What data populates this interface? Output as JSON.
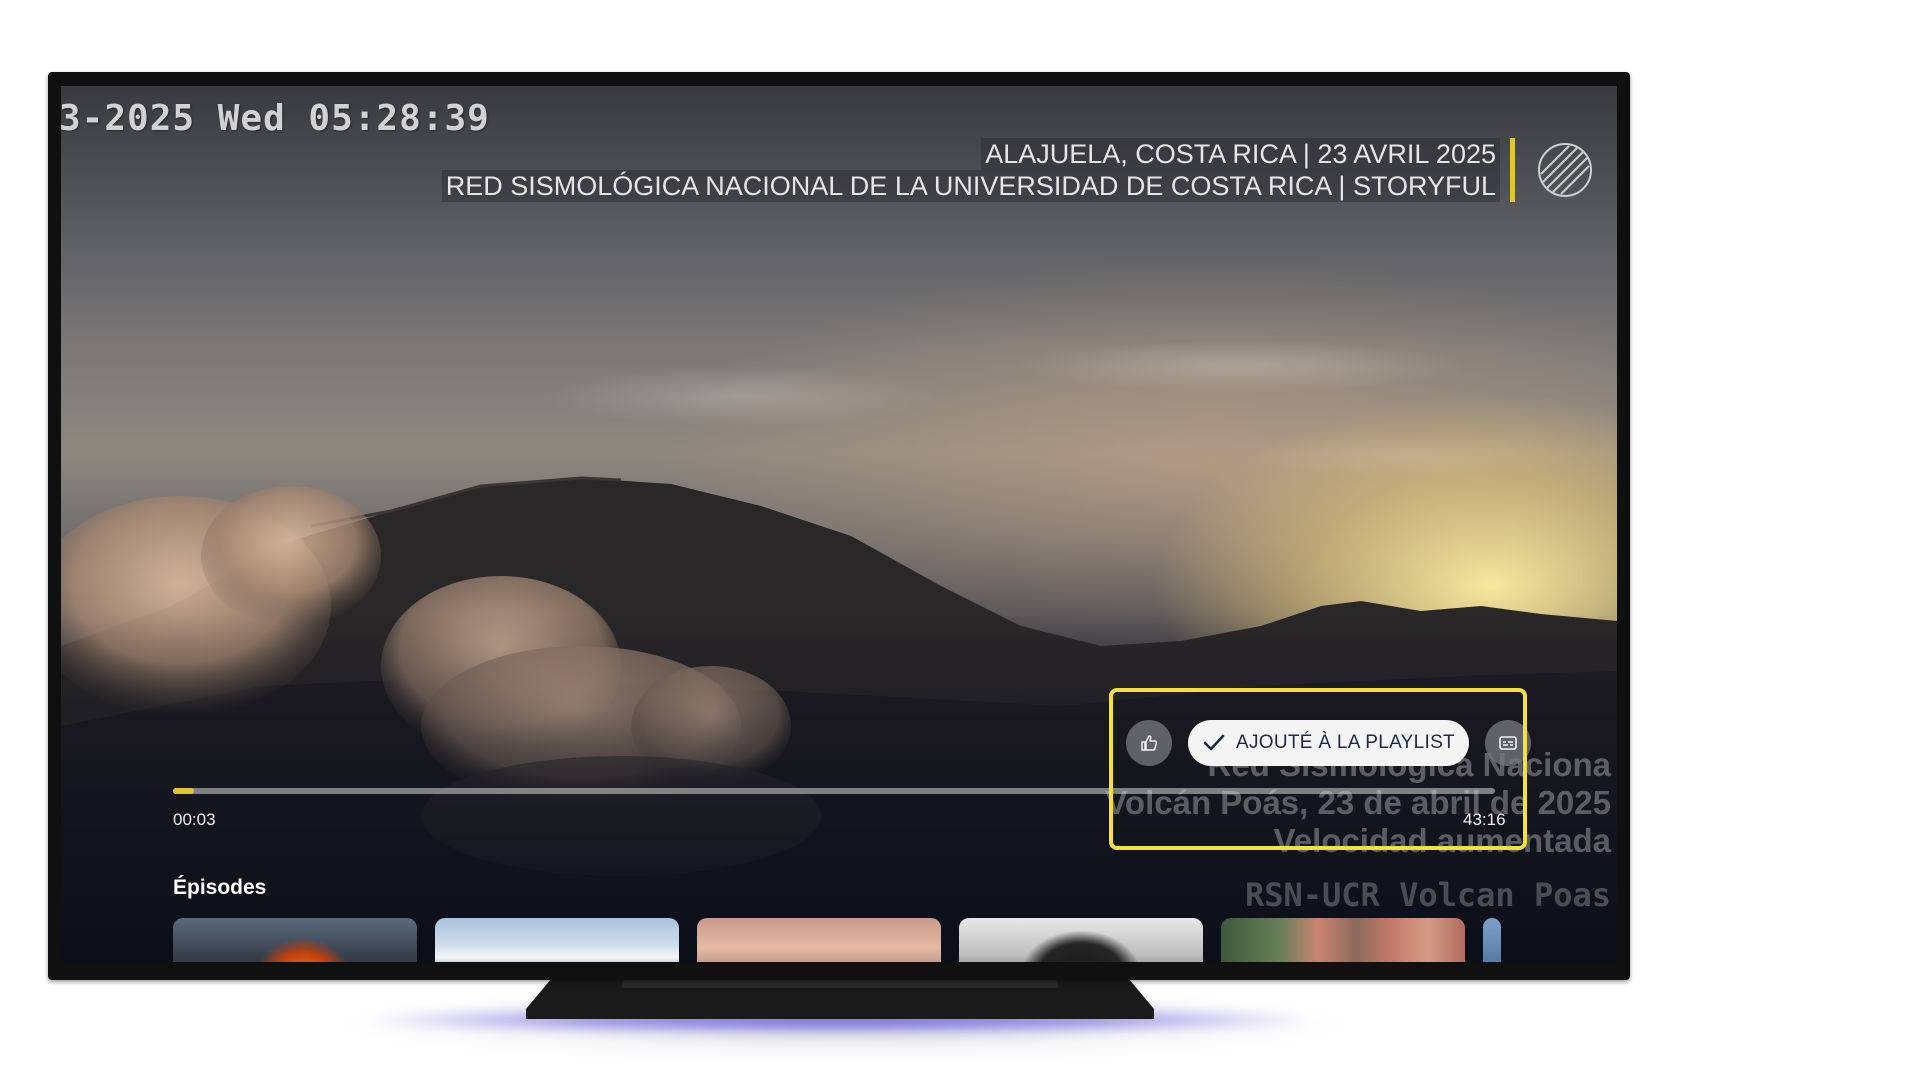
{
  "video": {
    "timestamp": "3-2025 Wed 05:28:39",
    "credit_line_1": "ALAJUELA, COSTA RICA | 23 AVRIL 2025",
    "credit_line_2": "RED SISMOLÓGICA NACIONAL DE LA UNIVERSIDAD DE COSTA RICA | STORYFUL",
    "lower_text_1": "Red Sismológica Naciona",
    "lower_text_2": "Volcán Poás, 23 de abril de 2025",
    "lower_text_3": "Velocidad aumentada",
    "lower_text_mono": "RSN-UCR Volcan Poas"
  },
  "player": {
    "like_icon": "thumbs-up-icon",
    "playlist_label": "AJOUTÉ À LA PLAYLIST",
    "playlist_icon": "checkmark-icon",
    "captions_icon": "closed-captions-icon",
    "current_time": "00:03",
    "total_time": "43:16",
    "progress": 0.0012,
    "accent_color": "#e2c62c",
    "focus_color": "#f3e23c"
  },
  "episodes": {
    "title": "Épisodes",
    "thumbnails": [
      "volcano-fire",
      "snowy-mountain",
      "sunset-clouds",
      "bear",
      "forest-legs",
      "partial"
    ]
  }
}
